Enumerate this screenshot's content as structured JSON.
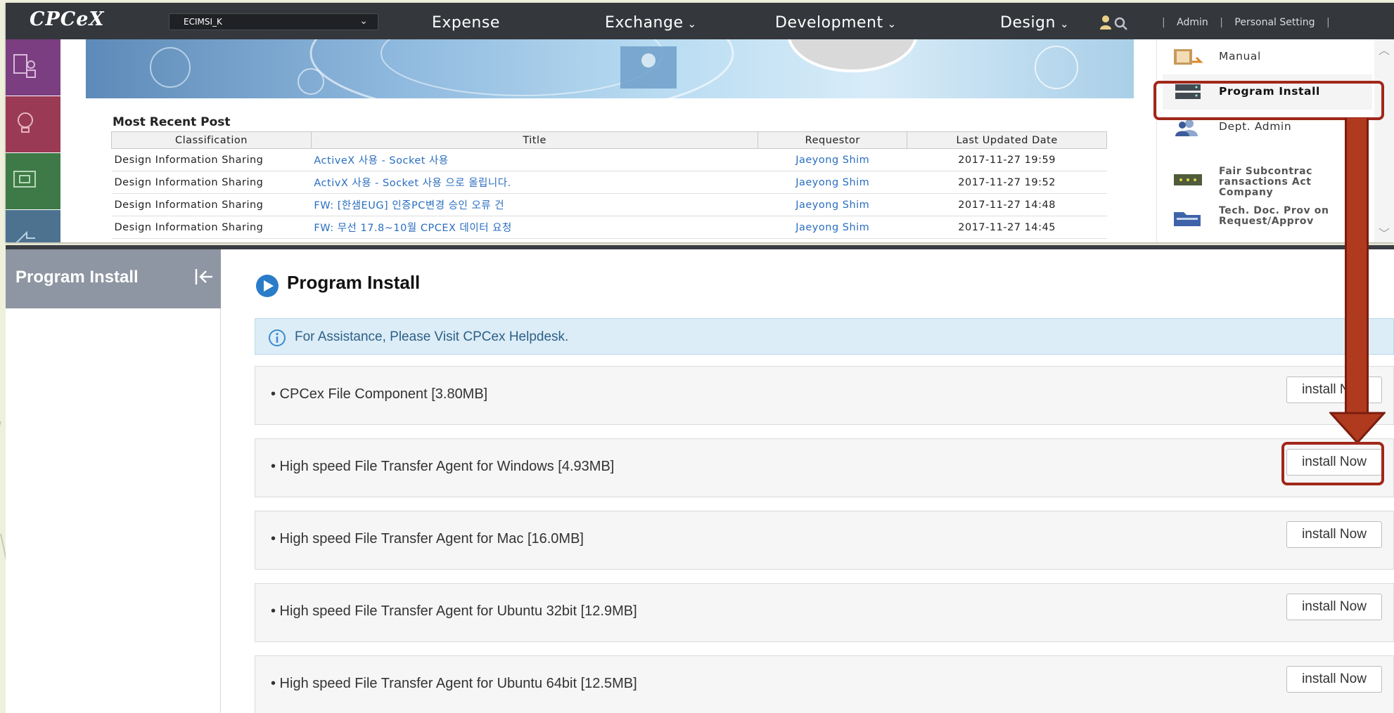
{
  "topnav": {
    "logo": "CPCeX",
    "company_select": "ECIMSI_K",
    "menus": [
      "Expense",
      "Exchange",
      "Development",
      "Design"
    ],
    "links": [
      "Admin",
      "Personal Setting"
    ]
  },
  "recent_posts": {
    "heading": "Most Recent Post",
    "columns": [
      "Classification",
      "Title",
      "Requestor",
      "Last Updated Date"
    ],
    "rows": [
      {
        "classification": "Design Information Sharing",
        "title": "ActiveX 사용 - Socket 사용",
        "requestor": "Jaeyong Shim",
        "date": "2017-11-27 19:59"
      },
      {
        "classification": "Design Information Sharing",
        "title": "ActivX 사용 - Socket 사용 으로 올립니다.",
        "requestor": "Jaeyong Shim",
        "date": "2017-11-27 19:52"
      },
      {
        "classification": "Design Information Sharing",
        "title": "FW: [한샘EUG] 인증PC변경 승인 오류 건",
        "requestor": "Jaeyong Shim",
        "date": "2017-11-27 14:48"
      },
      {
        "classification": "Design Information Sharing",
        "title": "FW: 무선 17.8~10월 CPCEX 데이터 요청",
        "requestor": "Jaeyong Shim",
        "date": "2017-11-27 14:45"
      }
    ]
  },
  "right_menu": {
    "items": [
      {
        "label": "Manual",
        "icon": "manual-icon"
      },
      {
        "label": "Program Install",
        "icon": "server-icon"
      },
      {
        "label": "Dept. Admin",
        "icon": "users-icon"
      },
      {
        "label": "Fair Subcontrac ransactions Act Company",
        "icon": "board-icon"
      },
      {
        "label": "Tech. Doc. Prov on Request/Approv",
        "icon": "folder-icon"
      }
    ]
  },
  "sidebar": {
    "title": "Program Install"
  },
  "main": {
    "title": "Program Install",
    "info": "For Assistance, Please Visit CPCex Helpdesk.",
    "programs": [
      {
        "name": "• CPCex File Component [3.80MB]",
        "button": "install Now"
      },
      {
        "name": "• High speed File Transfer Agent for Windows [4.93MB]",
        "button": "install Now"
      },
      {
        "name": "• High speed File Transfer Agent for Mac [16.0MB]",
        "button": "install Now"
      },
      {
        "name": "• High speed File Transfer Agent for Ubuntu 32bit [12.9MB]",
        "button": "install Now"
      },
      {
        "name": "• High speed File Transfer Agent for Ubuntu 64bit [12.5MB]",
        "button": "install Now"
      }
    ]
  },
  "colors": {
    "nav_bg": "#34373c",
    "callout": "#a0281a",
    "link": "#2a6ebf",
    "sidebar_header": "#8f96a3",
    "info_bg": "#dcedf7"
  }
}
